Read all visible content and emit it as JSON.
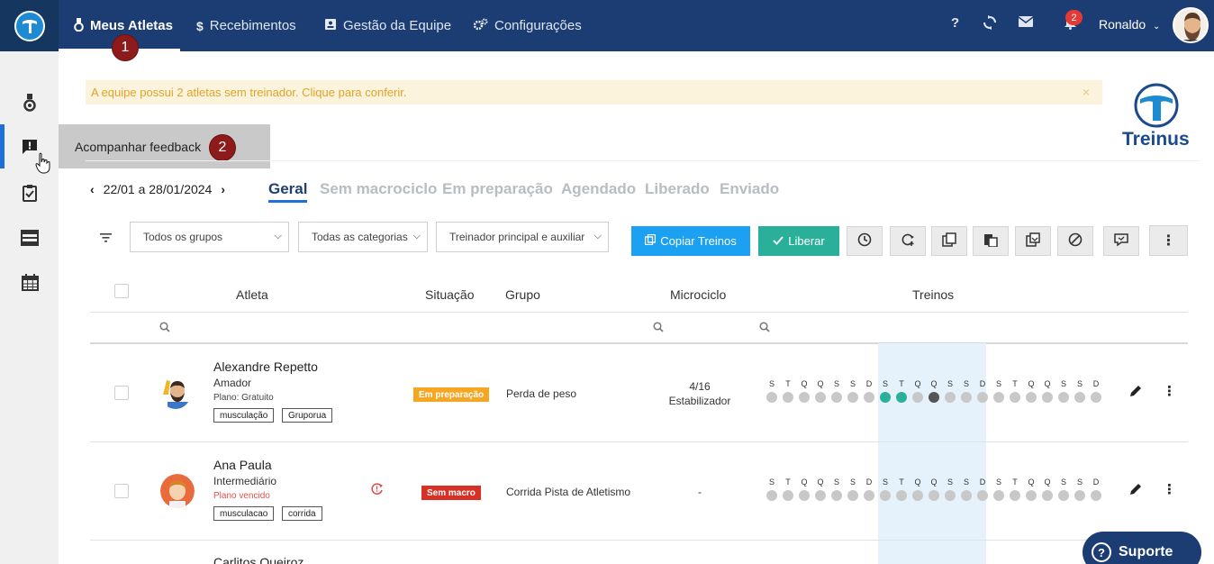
{
  "nav": {
    "items": [
      {
        "label": "Meus Atletas",
        "icon": "medal-icon"
      },
      {
        "label": "Recebimentos",
        "icon": "dollar-icon"
      },
      {
        "label": "Gestão da Equipe",
        "icon": "id-card-icon"
      },
      {
        "label": "Configurações",
        "icon": "gears-icon"
      }
    ],
    "step1": "1",
    "step2": "2",
    "help": "?",
    "notifications_count": "2",
    "user": "Ronaldo"
  },
  "sidebar": {
    "tooltip": "Acompanhar feedback"
  },
  "alert": {
    "text": "A equipe possui 2 atletas sem treinador. Clique para conferir.",
    "close": "×"
  },
  "brand": {
    "name": "Treinus"
  },
  "period": {
    "label": "22/01 a 28/01/2024"
  },
  "tabs": [
    "Geral",
    "Sem macrociclo",
    "Em preparação",
    "Agendado",
    "Liberado",
    "Enviado"
  ],
  "filters": {
    "groups": "Todos os grupos",
    "categories": "Todas as categorias",
    "coach": "Treinador principal e auxiliar"
  },
  "toolbar": {
    "copy": "Copiar Treinos",
    "release": "Liberar"
  },
  "table": {
    "headers": {
      "athlete": "Atleta",
      "status": "Situação",
      "group": "Grupo",
      "microcycle": "Microciclo",
      "trainings": "Treinos"
    },
    "week_letters": [
      "S",
      "T",
      "Q",
      "Q",
      "S",
      "S",
      "D",
      "S",
      "T",
      "Q",
      "Q",
      "S",
      "S",
      "D",
      "S",
      "T",
      "Q",
      "Q",
      "S",
      "S",
      "D"
    ],
    "rows": [
      {
        "name": "Alexandre Repetto",
        "level": "Amador",
        "plan": "Plano: Gratuito",
        "tags": [
          "musculação",
          "Gruporua"
        ],
        "status": "Em preparação",
        "status_color": "#f5a623",
        "group": "Perda de peso",
        "micro_count": "4/16",
        "micro_phase": "Estabilizador",
        "dots": [
          "#c8c8c8",
          "#c8c8c8",
          "#c8c8c8",
          "#c8c8c8",
          "#c8c8c8",
          "#c8c8c8",
          "#c8c8c8",
          "#2ab09a",
          "#2ab09a",
          "#c8c8c8",
          "#555555",
          "#c8c8c8",
          "#c8c8c8",
          "#c8c8c8",
          "#c8c8c8",
          "#c8c8c8",
          "#c8c8c8",
          "#c8c8c8",
          "#c8c8c8",
          "#c8c8c8",
          "#c8c8c8"
        ]
      },
      {
        "name": "Ana Paula",
        "level": "Intermediário",
        "plan": "Plano vencido",
        "tags": [
          "musculacao",
          "corrida"
        ],
        "status": "Sem macro",
        "status_color": "#d93025",
        "group": "Corrida Pista de Atletismo",
        "micro_count": "-",
        "micro_phase": "",
        "dots": [
          "#c8c8c8",
          "#c8c8c8",
          "#c8c8c8",
          "#c8c8c8",
          "#c8c8c8",
          "#c8c8c8",
          "#c8c8c8",
          "#c8c8c8",
          "#c8c8c8",
          "#c8c8c8",
          "#c8c8c8",
          "#c8c8c8",
          "#c8c8c8",
          "#c8c8c8",
          "#c8c8c8",
          "#c8c8c8",
          "#c8c8c8",
          "#c8c8c8",
          "#c8c8c8",
          "#c8c8c8",
          "#c8c8c8"
        ]
      },
      {
        "name": "Carlitos Queiroz"
      }
    ]
  },
  "support": {
    "label": "Suporte",
    "icon_text": "?"
  }
}
